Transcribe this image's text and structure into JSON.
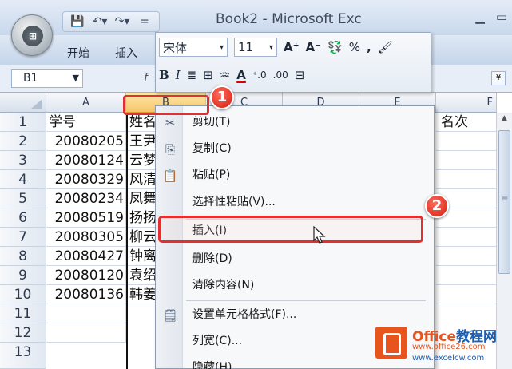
{
  "window": {
    "title": "Book2 - Microsoft Exc",
    "office_button_logo": "Office"
  },
  "quick_access": {
    "icons": [
      "save-icon",
      "undo-icon",
      "redo-icon",
      "customize-icon"
    ],
    "glyphs": [
      "💾",
      "↶▾",
      "↷▾",
      "="
    ]
  },
  "ribbon": {
    "tabs": [
      "开始",
      "插入"
    ]
  },
  "formula_bar": {
    "name_box": "B1",
    "fx": "f"
  },
  "mini_toolbar": {
    "font_name": "宋体",
    "font_size": "11",
    "row1_icons": [
      "A⁺",
      "A⁻",
      "💱",
      "%",
      ",",
      "🖌"
    ],
    "row2_icons": [
      "B",
      "I",
      "≣",
      "⊞",
      "♒",
      "A",
      "⁺.0",
      ".00",
      "⊟"
    ]
  },
  "columns": [
    "A",
    "B",
    "C",
    "D",
    "E",
    "F"
  ],
  "rows": [
    "1",
    "2",
    "3",
    "4",
    "5",
    "6",
    "7",
    "8",
    "9",
    "10",
    "11",
    "12",
    "13"
  ],
  "sheet": {
    "header_a": "学号",
    "header_b": "姓名",
    "header_f": "名次",
    "student_ids": [
      "20080205",
      "20080124",
      "20080329",
      "20080234",
      "20080519",
      "20080305",
      "20080427",
      "20080120",
      "20080136"
    ],
    "name_fragments": [
      "王尹",
      "云梦",
      "风清",
      "凤舞",
      "扬扬",
      "柳云",
      "钟离",
      "袁绍",
      "韩姜"
    ]
  },
  "context_menu": {
    "items": [
      {
        "label": "剪切(T)",
        "icon": "✂"
      },
      {
        "label": "复制(C)",
        "icon": "⎘"
      },
      {
        "label": "粘贴(P)",
        "icon": "📋"
      },
      {
        "label": "选择性粘贴(V)...",
        "icon": ""
      },
      {
        "label": "插入(I)",
        "icon": ""
      },
      {
        "label": "删除(D)",
        "icon": ""
      },
      {
        "label": "清除内容(N)",
        "icon": ""
      },
      {
        "label": "设置单元格格式(F)...",
        "icon": "🗒"
      },
      {
        "label": "列宽(C)...",
        "icon": ""
      },
      {
        "label": "隐藏(H)",
        "icon": ""
      }
    ]
  },
  "annotations": {
    "step1": "1",
    "step2": "2"
  },
  "watermark": {
    "brand_a": "Office",
    "brand_b": "教程网",
    "site1": "www.office26.com",
    "site2": "www.excelcw.com"
  }
}
